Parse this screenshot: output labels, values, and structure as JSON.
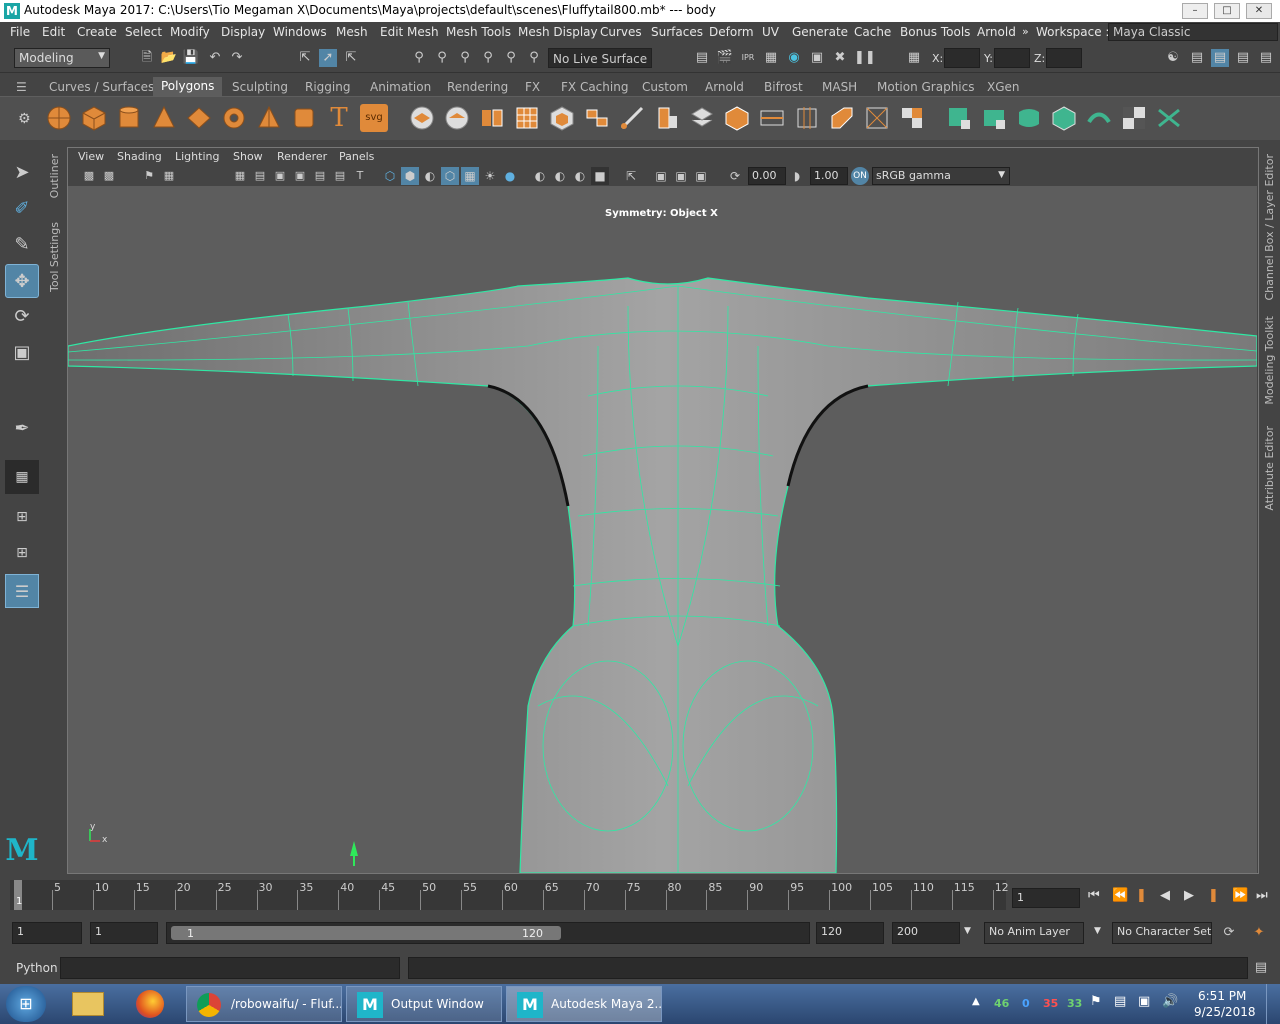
{
  "window": {
    "title": "Autodesk Maya 2017: C:\\Users\\Tio Megaman X\\Documents\\Maya\\projects\\default\\scenes\\Fluffytail800.mb*   ---   body"
  },
  "menus": [
    "File",
    "Edit",
    "Create",
    "Select",
    "Modify",
    "Display",
    "Windows",
    "Mesh",
    "Edit Mesh",
    "Mesh Tools",
    "Mesh Display",
    "Curves",
    "Surfaces",
    "Deform",
    "UV",
    "Generate",
    "Cache",
    "Bonus Tools",
    "Arnold"
  ],
  "workspace": {
    "label": "Workspace :",
    "value": "Maya Classic"
  },
  "status": {
    "menuset": "Modeling",
    "live_surface": "No Live Surface",
    "x": "X:",
    "y": "Y:",
    "z": "Z:"
  },
  "shelf_tabs": [
    "Curves / Surfaces",
    "Polygons",
    "Sculpting",
    "Rigging",
    "Animation",
    "Rendering",
    "FX",
    "FX Caching",
    "Custom",
    "Arnold",
    "Bifrost",
    "MASH",
    "Motion Graphics",
    "XGen"
  ],
  "shelf_active": "Polygons",
  "left_tabs": {
    "outliner": "Outliner",
    "tool_settings": "Tool Settings"
  },
  "right_tabs": {
    "channel_box": "Channel Box / Layer Editor",
    "modeling_toolkit": "Modeling Toolkit",
    "attribute_editor": "Attribute Editor"
  },
  "panel_menu": [
    "View",
    "Shading",
    "Lighting",
    "Show",
    "Renderer",
    "Panels"
  ],
  "panel_toolbar": {
    "exposure": "0.00",
    "gamma": "1.00",
    "color_space": "sRGB gamma"
  },
  "viewport": {
    "hud": "Symmetry: Object X",
    "axis_x": "x",
    "axis_y": "y"
  },
  "timeline": {
    "ticks": [
      "5",
      "10",
      "15",
      "20",
      "25",
      "30",
      "35",
      "40",
      "45",
      "50",
      "55",
      "60",
      "65",
      "70",
      "75",
      "80",
      "85",
      "90",
      "95",
      "100",
      "105",
      "110",
      "115",
      "12"
    ],
    "current_frame": "1",
    "current_frame_field": "1"
  },
  "range": {
    "start": "1",
    "playback_start": "1",
    "slider_start": "1",
    "slider_end": "120",
    "playback_end": "120",
    "end": "200",
    "anim_layer": "No Anim Layer",
    "char_set": "No Character Set"
  },
  "cmdline": {
    "label": "Python"
  },
  "taskbar": {
    "tasks": [
      "/robowaifu/ - Fluf...",
      "Output Window",
      "Autodesk Maya 2..."
    ],
    "tray_nums": [
      "46",
      "0",
      "35",
      "33"
    ],
    "time": "6:51 PM",
    "date": "9/25/2018"
  }
}
